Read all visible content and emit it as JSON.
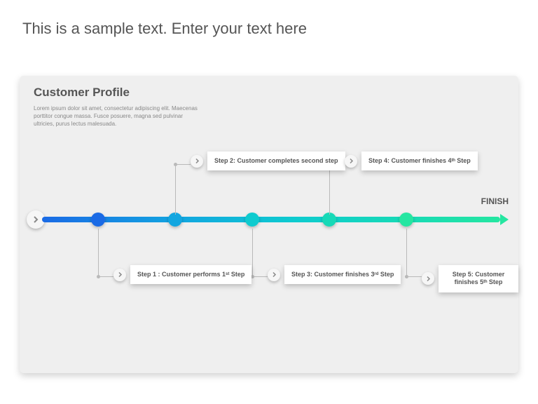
{
  "slide": {
    "title": "This is a sample text. Enter your text here"
  },
  "panel": {
    "title": "Customer Profile",
    "description": "Lorem ipsum dolor sit amet, consectetur adipiscing elit. Maecenas porttitor congue massa. Fusce posuere, magna sed pulvinar ultricies, purus lectus malesuada.",
    "finish_label": "FINISH"
  },
  "timeline": {
    "gradient_colors": [
      "#1a6ae5",
      "#12a6e0",
      "#0ecbcf",
      "#17d9b7",
      "#25e6a1"
    ],
    "steps": [
      {
        "label": "Step 1 : Customer performs 1ˢᵗ Step",
        "position": "below"
      },
      {
        "label": "Step 2: Customer completes second step",
        "position": "above"
      },
      {
        "label": "Step 3: Customer finishes 3ʳᵈ Step",
        "position": "below"
      },
      {
        "label": "Step 4: Customer finishes 4ᵗʰ Step",
        "position": "above"
      },
      {
        "label": "Step 5: Customer finishes 5ᵗʰ Step",
        "position": "below"
      }
    ]
  }
}
